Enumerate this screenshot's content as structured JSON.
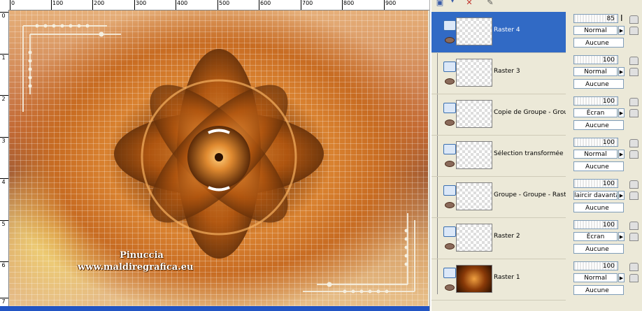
{
  "ruler": {
    "top_ticks": [
      "0",
      "100",
      "200",
      "300",
      "400",
      "500",
      "600",
      "700",
      "800",
      "900"
    ],
    "left_ticks": [
      "0",
      "1",
      "2",
      "3",
      "4",
      "5",
      "6",
      "7"
    ]
  },
  "canvas": {
    "watermark_line1": "Pinuccia",
    "watermark_line2": "www.maldiregrafica.eu"
  },
  "toolbar": {
    "icons": [
      "new-layer-icon",
      "delete-layer-icon",
      "properties-icon"
    ]
  },
  "layers": [
    {
      "name": "Raster 4",
      "opacity": "85",
      "blend": "Normal",
      "mask": "Aucune",
      "selected": true
    },
    {
      "name": "Raster 3",
      "opacity": "100",
      "blend": "Normal",
      "mask": "Aucune",
      "selected": false
    },
    {
      "name": "Copie de Groupe - Groupe",
      "opacity": "100",
      "blend": "Écran",
      "mask": "Aucune",
      "selected": false
    },
    {
      "name": "Sélection transformée",
      "opacity": "100",
      "blend": "Normal",
      "mask": "Aucune",
      "selected": false
    },
    {
      "name": "Groupe - Groupe - Raster",
      "opacity": "100",
      "blend": "laircir davantage",
      "mask": "Aucune",
      "selected": false
    },
    {
      "name": "Raster 2",
      "opacity": "100",
      "blend": "Écran",
      "mask": "Aucune",
      "selected": false
    },
    {
      "name": "Raster 1",
      "opacity": "100",
      "blend": "Normal",
      "mask": "Aucune",
      "selected": false
    }
  ],
  "colors": {
    "selection": "#316ac5",
    "panel": "#ece9d8",
    "accent_orange": "#d98230"
  }
}
